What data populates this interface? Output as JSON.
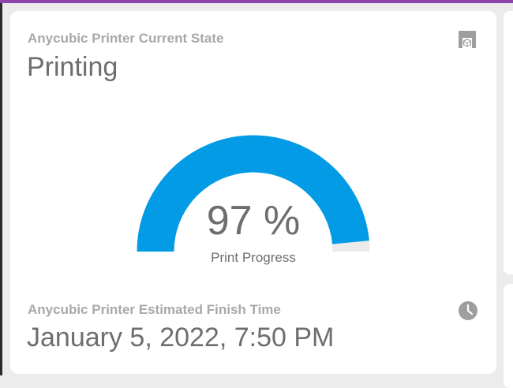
{
  "state_card": {
    "label": "Anycubic Printer Current State",
    "value": "Printing",
    "icon": "printer-3d-icon"
  },
  "progress": {
    "value": 97,
    "display": "97 %",
    "caption": "Print Progress",
    "fill_color": "#039be5",
    "track_color": "#ebebeb"
  },
  "finish_card": {
    "label": "Anycubic Printer Estimated Finish Time",
    "value": "January 5, 2022, 7:50 PM",
    "icon": "clock-icon"
  },
  "colors": {
    "accent_bar": "#8e44ad",
    "label_text": "#a8a8a8",
    "value_text": "#6e6e6e",
    "icon": "#9e9e9e"
  }
}
